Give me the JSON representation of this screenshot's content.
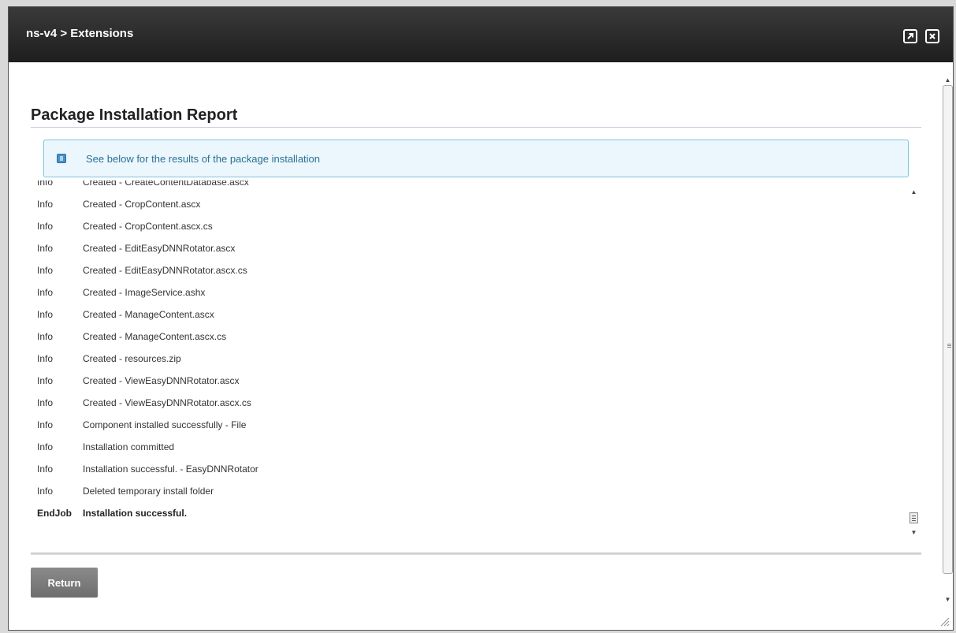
{
  "window": {
    "title": "ns-v4 > Extensions",
    "maximize_icon": "arrow-up-right-icon",
    "close_icon": "close-icon"
  },
  "report": {
    "heading": "Package Installation Report",
    "info_message": "See below for the results of the package installation",
    "log": [
      {
        "type": "Info",
        "message": "Created - CreateContentDatabase.ascx"
      },
      {
        "type": "Info",
        "message": "Created - CropContent.ascx"
      },
      {
        "type": "Info",
        "message": "Created - CropContent.ascx.cs"
      },
      {
        "type": "Info",
        "message": "Created - EditEasyDNNRotator.ascx"
      },
      {
        "type": "Info",
        "message": "Created - EditEasyDNNRotator.ascx.cs"
      },
      {
        "type": "Info",
        "message": "Created - ImageService.ashx"
      },
      {
        "type": "Info",
        "message": "Created - ManageContent.ascx"
      },
      {
        "type": "Info",
        "message": "Created - ManageContent.ascx.cs"
      },
      {
        "type": "Info",
        "message": "Created - resources.zip"
      },
      {
        "type": "Info",
        "message": "Created - ViewEasyDNNRotator.ascx"
      },
      {
        "type": "Info",
        "message": "Created - ViewEasyDNNRotator.ascx.cs"
      },
      {
        "type": "Info",
        "message": "Component installed successfully - File"
      },
      {
        "type": "Info",
        "message": "Installation committed"
      },
      {
        "type": "Info",
        "message": "Installation successful. - EasyDNNRotator"
      },
      {
        "type": "Info",
        "message": "Deleted temporary install folder"
      },
      {
        "type": "EndJob",
        "message": "Installation successful."
      }
    ]
  },
  "actions": {
    "return_label": "Return"
  }
}
